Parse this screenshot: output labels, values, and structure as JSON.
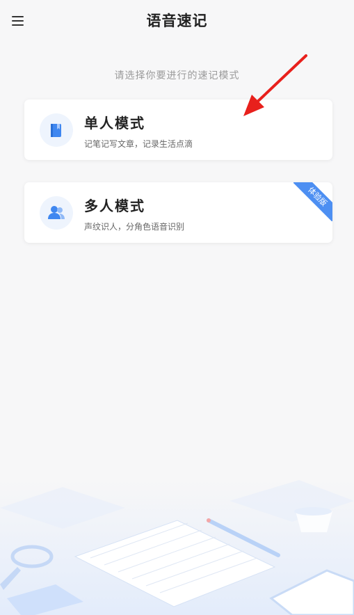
{
  "header": {
    "title": "语音速记"
  },
  "main": {
    "prompt": "请选择你要进行的速记模式",
    "modes": [
      {
        "title": "单人模式",
        "description": "记笔记写文章，记录生活点滴",
        "icon": "notebook-icon"
      },
      {
        "title": "多人模式",
        "description": "声纹识人，分角色语音识别",
        "icon": "people-icon",
        "badge": "体验版"
      }
    ]
  },
  "colors": {
    "accent": "#4d8ff2",
    "arrow": "#e8201c",
    "background": "#f7f7f8"
  }
}
